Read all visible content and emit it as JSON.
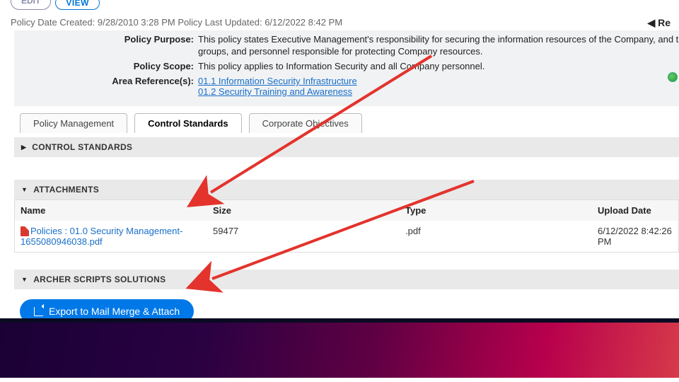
{
  "topButtons": {
    "edit": "EDIT",
    "view": "VIEW"
  },
  "back": "Re",
  "meta": {
    "createdLabel": "Policy Date Created:",
    "createdVal": "9/28/2010 3:28 PM",
    "updatedLabel": "Policy Last Updated:",
    "updatedVal": "6/12/2022 8:42 PM"
  },
  "info": {
    "purposeLabel": "Policy Purpose:",
    "purposeVal": "This policy states Executive Management's responsibility for securing the information resources of the Company, and their delegation of that responsibility to appropriate groups, and personnel responsible for protecting Company resources.",
    "scopeLabel": "Policy Scope:",
    "scopeVal": "This policy applies to Information Security and all Company personnel.",
    "areaLabel": "Area Reference(s):",
    "areaLinks": [
      "01.1 Information Security Infrastructure",
      "01.2 Security Training and Awareness"
    ]
  },
  "tabs": {
    "pm": "Policy Management",
    "cs": "Control Standards",
    "co": "Corporate Objectives"
  },
  "sections": {
    "cs": "CONTROL STANDARDS",
    "att": "ATTACHMENTS",
    "ass": "ARCHER SCRIPTS SOLUTIONS"
  },
  "table": {
    "headers": {
      "name": "Name",
      "size": "Size",
      "type": "Type",
      "upload": "Upload Date"
    },
    "row": {
      "name": "Policies : 01.0 Security Management-1655080946038.pdf",
      "size": "59477",
      "type": ".pdf",
      "upload": "6/12/2022 8:42:26 PM"
    }
  },
  "exportBtn": "Export to Mail Merge & Attach"
}
